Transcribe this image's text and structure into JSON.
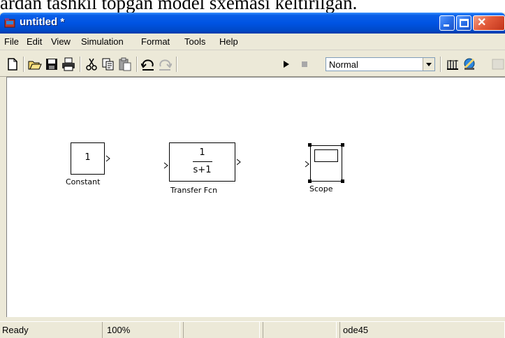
{
  "document_strip": {
    "text": "ardan tashkil topgan model sxemasi keltirilgan."
  },
  "window": {
    "title": "untitled *"
  },
  "menubar": {
    "items": [
      "File",
      "Edit",
      "View",
      "Simulation",
      "Format",
      "Tools",
      "Help"
    ]
  },
  "toolbar": {
    "simulation_mode": "Normal",
    "icons": [
      "new-icon",
      "open-icon",
      "save-icon",
      "print-icon",
      "cut-icon",
      "copy-icon",
      "paste-icon",
      "undo-icon",
      "redo-icon",
      "play-icon",
      "stop-icon",
      "library-browser-icon",
      "model-explorer-icon"
    ]
  },
  "canvas": {
    "blocks": [
      {
        "type": "Constant",
        "value": "1",
        "label": "Constant"
      },
      {
        "type": "Transfer Fcn",
        "numerator": "1",
        "denominator": "s+1",
        "label": "Transfer Fcn"
      },
      {
        "type": "Scope",
        "label": "Scope"
      }
    ]
  },
  "statusbar": {
    "status": "Ready",
    "zoom": "100%",
    "solver": "ode45"
  },
  "colors": {
    "titlebar": "#0054e3",
    "chrome": "#ece9d8",
    "canvas": "#ffffff"
  }
}
